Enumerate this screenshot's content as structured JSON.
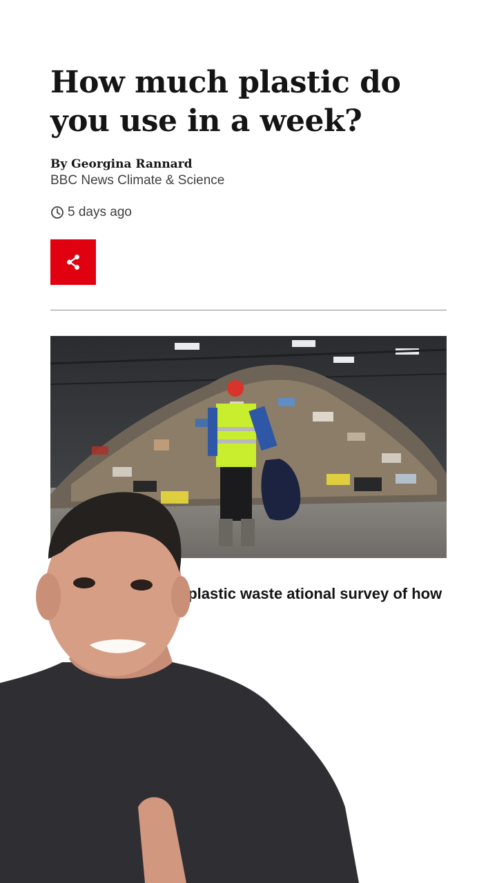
{
  "article": {
    "headline": "How much plastic do you use in a week?",
    "author": "By Georgina Rannard",
    "department": "BBC News Climate & Science",
    "timestamp": "5 days ago",
    "lead_visible": "ple will count their plastic waste ational survey of how much we c"
  },
  "icons": {
    "share": "share-icon",
    "clock": "clock-icon"
  },
  "colors": {
    "share_button": "#e0000f",
    "text": "#141414",
    "secondary_text": "#3f3f42"
  }
}
